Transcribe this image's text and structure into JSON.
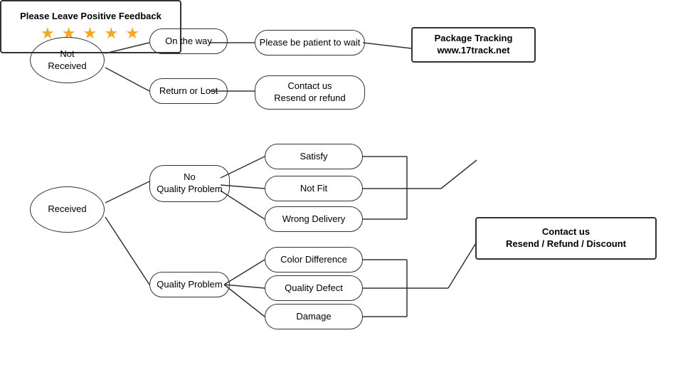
{
  "nodes": {
    "not_received": {
      "label": "Not\nReceived"
    },
    "on_the_way": {
      "label": "On the way"
    },
    "patient": {
      "label": "Please be patient to wait"
    },
    "package_tracking": {
      "label": "Package Tracking\nwww.17track.net"
    },
    "return_lost": {
      "label": "Return or Lost"
    },
    "contact_resend_refund": {
      "label": "Contact us\nResend or refund"
    },
    "received": {
      "label": "Received"
    },
    "no_quality": {
      "label": "No\nQuality Problem"
    },
    "satisfy": {
      "label": "Satisfy"
    },
    "not_fit": {
      "label": "Not Fit"
    },
    "wrong_delivery": {
      "label": "Wrong Delivery"
    },
    "feedback": {
      "label": "Please Leave Positive Feedback"
    },
    "stars": {
      "label": "★ ★ ★ ★ ★"
    },
    "quality_problem": {
      "label": "Quality Problem"
    },
    "color_diff": {
      "label": "Color Difference"
    },
    "quality_defect": {
      "label": "Quality Defect"
    },
    "damage": {
      "label": "Damage"
    },
    "contact_resend_discount": {
      "label": "Contact us\nResend / Refund / Discount"
    }
  }
}
